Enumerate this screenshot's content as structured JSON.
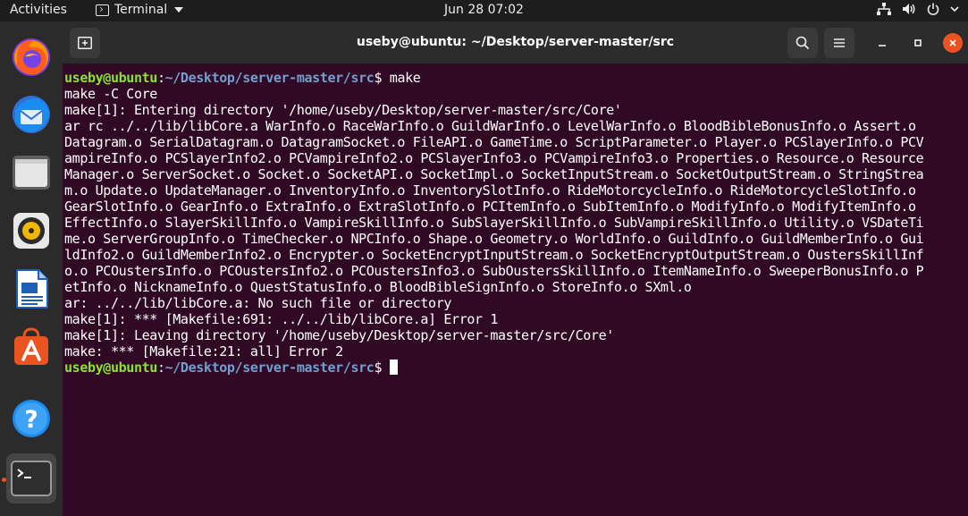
{
  "topbar": {
    "activities": "Activities",
    "app_name": "Terminal",
    "clock": "Jun 28  07:02"
  },
  "dock": {
    "apps": [
      {
        "name": "firefox-icon"
      },
      {
        "name": "thunderbird-icon"
      },
      {
        "name": "files-icon"
      },
      {
        "name": "rhythmbox-icon"
      },
      {
        "name": "libreoffice-writer-icon"
      },
      {
        "name": "software-center-icon"
      },
      {
        "name": "help-icon"
      },
      {
        "name": "terminal-icon"
      }
    ]
  },
  "window": {
    "title": "useby@ubuntu: ~/Desktop/server-master/src"
  },
  "terminal": {
    "prompt_user": "useby@ubuntu",
    "prompt_sep": ":",
    "prompt_path": "~/Desktop/server-master/src",
    "prompt_dollar": "$ ",
    "command": "make",
    "output": [
      "make -C Core",
      "make[1]: Entering directory '/home/useby/Desktop/server-master/src/Core'",
      "ar rc ../../lib/libCore.a WarInfo.o RaceWarInfo.o GuildWarInfo.o LevelWarInfo.o BloodBibleBonusInfo.o Assert.o",
      "Datagram.o SerialDatagram.o DatagramSocket.o FileAPI.o GameTime.o ScriptParameter.o Player.o PCSlayerInfo.o PCV",
      "ampireInfo.o PCSlayerInfo2.o PCVampireInfo2.o PCSlayerInfo3.o PCVampireInfo3.o Properties.o Resource.o Resource",
      "Manager.o ServerSocket.o Socket.o SocketAPI.o SocketImpl.o SocketInputStream.o SocketOutputStream.o StringStrea",
      "m.o Update.o UpdateManager.o InventoryInfo.o InventorySlotInfo.o RideMotorcycleInfo.o RideMotorcycleSlotInfo.o",
      "GearSlotInfo.o GearInfo.o ExtraInfo.o ExtraSlotInfo.o PCItemInfo.o SubItemInfo.o ModifyInfo.o ModifyItemInfo.o",
      "EffectInfo.o SlayerSkillInfo.o VampireSkillInfo.o SubSlayerSkillInfo.o SubVampireSkillInfo.o Utility.o VSDateTi",
      "me.o ServerGroupInfo.o TimeChecker.o NPCInfo.o Shape.o Geometry.o WorldInfo.o GuildInfo.o GuildMemberInfo.o Gui",
      "ldInfo2.o GuildMemberInfo2.o Encrypter.o SocketEncryptInputStream.o SocketEncryptOutputStream.o OustersSkillInf",
      "o.o PCOustersInfo.o PCOustersInfo2.o PCOustersInfo3.o SubOustersSkillInfo.o ItemNameInfo.o SweeperBonusInfo.o P",
      "etInfo.o NicknameInfo.o QuestStatusInfo.o BloodBibleSignInfo.o StoreInfo.o SXml.o",
      "ar: ../../lib/libCore.a: No such file or directory",
      "make[1]: *** [Makefile:691: ../../lib/libCore.a] Error 1",
      "make[1]: Leaving directory '/home/useby/Desktop/server-master/src/Core'",
      "make: *** [Makefile:21: all] Error 2"
    ]
  },
  "colors": {
    "terminal_bg": "#300a24",
    "prompt_user": "#8ae234",
    "prompt_path": "#729fcf",
    "accent": "#e95420",
    "close_button": "#e95420"
  }
}
